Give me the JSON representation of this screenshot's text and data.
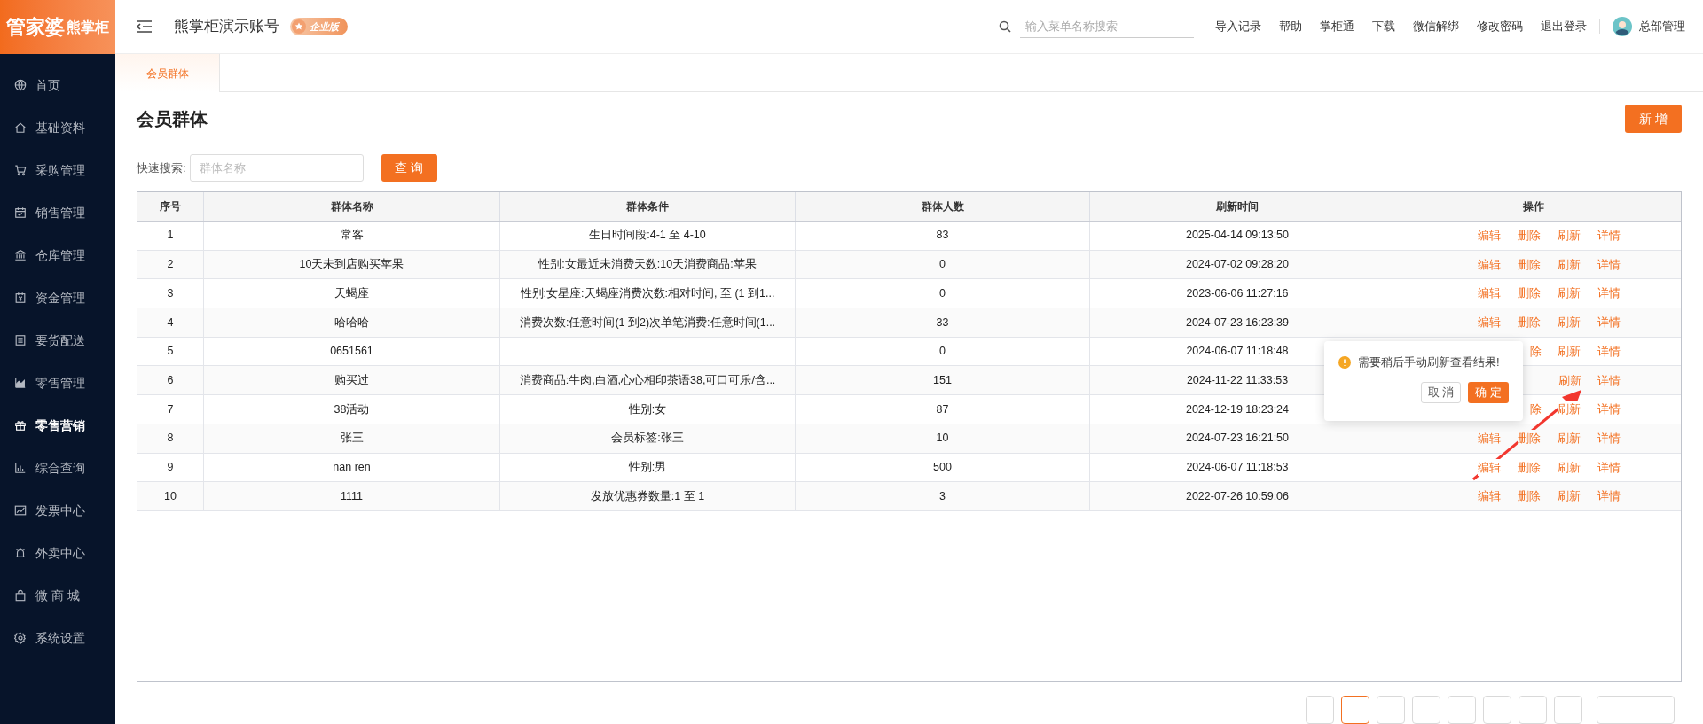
{
  "logo": {
    "brand": "管家婆",
    "product": "熊掌柜"
  },
  "sidebar": {
    "items": [
      {
        "label": "首页",
        "selected": false
      },
      {
        "label": "基础资料",
        "selected": false
      },
      {
        "label": "采购管理",
        "selected": false
      },
      {
        "label": "销售管理",
        "selected": false
      },
      {
        "label": "仓库管理",
        "selected": false
      },
      {
        "label": "资金管理",
        "selected": false
      },
      {
        "label": "要货配送",
        "selected": false
      },
      {
        "label": "零售管理",
        "selected": false
      },
      {
        "label": "零售营销",
        "selected": true
      },
      {
        "label": "综合查询",
        "selected": false
      },
      {
        "label": "发票中心",
        "selected": false
      },
      {
        "label": "外卖中心",
        "selected": false
      },
      {
        "label": "微 商 城",
        "selected": false
      },
      {
        "label": "系统设置",
        "selected": false
      }
    ]
  },
  "header": {
    "account": "熊掌柜演示账号",
    "edition_badge": "企业版",
    "search": {
      "placeholder": "输入菜单名称搜索"
    },
    "links": [
      "导入记录",
      "帮助",
      "掌柜通",
      "下载",
      "微信解绑",
      "修改密码",
      "退出登录"
    ],
    "user": "总部管理"
  },
  "tabs": [
    {
      "label": "会员群体",
      "selected": true
    }
  ],
  "page": {
    "title": "会员群体",
    "add_button": "新 增",
    "quick_search": {
      "label": "快速搜索:",
      "placeholder": "群体名称"
    },
    "query_button": "查 询"
  },
  "table": {
    "columns": [
      "序号",
      "群体名称",
      "群体条件",
      "群体人数",
      "刷新时间",
      "操作"
    ],
    "rows": [
      {
        "no": "1",
        "name": "常客",
        "condition": "生日时间段:4-1 至 4-10",
        "count": "83",
        "time": "2025-04-14 09:13:50",
        "actions": [
          "编辑",
          "删除",
          "刷新",
          "详情"
        ]
      },
      {
        "no": "2",
        "name": "10天未到店购买苹果",
        "condition": "性别:女最近未消费天数:10天消费商品:苹果",
        "count": "0",
        "time": "2024-07-02 09:28:20",
        "actions": [
          "编辑",
          "删除",
          "刷新",
          "详情"
        ]
      },
      {
        "no": "3",
        "name": "天蝎座",
        "condition": "性别:女星座:天蝎座消费次数:相对时间, 至 (1 到1...",
        "count": "0",
        "time": "2023-06-06 11:27:16",
        "actions": [
          "编辑",
          "删除",
          "刷新",
          "详情"
        ]
      },
      {
        "no": "4",
        "name": "哈哈哈",
        "condition": "消费次数:任意时间(1 到2)次单笔消费:任意时间(1...",
        "count": "33",
        "time": "2024-07-23 16:23:39",
        "actions": [
          "编辑",
          "删除",
          "刷新",
          "详情"
        ]
      },
      {
        "no": "5",
        "name": "0651561",
        "count": "0",
        "time": "2024-06-07 11:18:48",
        "actions": [
          "除",
          "刷新",
          "详情"
        ]
      },
      {
        "no": "6",
        "name": "购买过",
        "condition": "消费商品:牛肉,白酒,心心相印茶语38,可口可乐/含...",
        "count": "151",
        "time": "2024-11-22 11:33:53",
        "actions": [
          "刷新",
          "详情"
        ]
      },
      {
        "no": "7",
        "name": "38活动",
        "condition": "性别:女",
        "count": "87",
        "time": "2024-12-19 18:23:24",
        "actions": [
          "除",
          "刷新",
          "详情"
        ]
      },
      {
        "no": "8",
        "name": "张三",
        "condition": "会员标签:张三",
        "count": "10",
        "time": "2024-07-23 16:21:50",
        "actions": [
          "编辑",
          "删除",
          "刷新",
          "详情"
        ]
      },
      {
        "no": "9",
        "name": "nan ren",
        "condition": "性别:男",
        "count": "500",
        "time": "2024-06-07 11:18:53",
        "actions": [
          "编辑",
          "删除",
          "刷新",
          "详情"
        ]
      },
      {
        "no": "10",
        "name": "1111",
        "condition": "发放优惠券数量:1 至 1",
        "count": "3",
        "time": "2022-07-26 10:59:06",
        "actions": [
          "编辑",
          "删除",
          "刷新",
          "详情"
        ]
      }
    ]
  },
  "popconfirm": {
    "message": "需要稍后手动刷新查看结果!",
    "cancel": "取 消",
    "confirm": "确 定"
  },
  "pagination": {
    "buttons": [
      {
        "kind": "page",
        "selected": false
      },
      {
        "kind": "page",
        "selected": true
      },
      {
        "kind": "page",
        "selected": false
      },
      {
        "kind": "page",
        "selected": false
      },
      {
        "kind": "page",
        "selected": false
      },
      {
        "kind": "page",
        "selected": false
      },
      {
        "kind": "page",
        "selected": false
      },
      {
        "kind": "page",
        "selected": false
      },
      {
        "kind": "size",
        "selected": false
      }
    ]
  }
}
